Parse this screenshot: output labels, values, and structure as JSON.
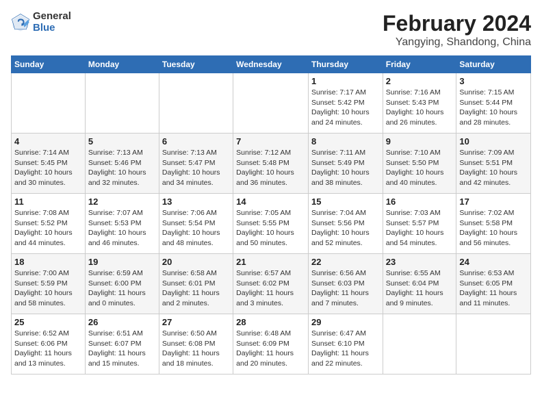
{
  "logo": {
    "general": "General",
    "blue": "Blue"
  },
  "title": "February 2024",
  "location": "Yangying, Shandong, China",
  "days_of_week": [
    "Sunday",
    "Monday",
    "Tuesday",
    "Wednesday",
    "Thursday",
    "Friday",
    "Saturday"
  ],
  "weeks": [
    [
      {
        "day": "",
        "info": ""
      },
      {
        "day": "",
        "info": ""
      },
      {
        "day": "",
        "info": ""
      },
      {
        "day": "",
        "info": ""
      },
      {
        "day": "1",
        "info": "Sunrise: 7:17 AM\nSunset: 5:42 PM\nDaylight: 10 hours and 24 minutes."
      },
      {
        "day": "2",
        "info": "Sunrise: 7:16 AM\nSunset: 5:43 PM\nDaylight: 10 hours and 26 minutes."
      },
      {
        "day": "3",
        "info": "Sunrise: 7:15 AM\nSunset: 5:44 PM\nDaylight: 10 hours and 28 minutes."
      }
    ],
    [
      {
        "day": "4",
        "info": "Sunrise: 7:14 AM\nSunset: 5:45 PM\nDaylight: 10 hours and 30 minutes."
      },
      {
        "day": "5",
        "info": "Sunrise: 7:13 AM\nSunset: 5:46 PM\nDaylight: 10 hours and 32 minutes."
      },
      {
        "day": "6",
        "info": "Sunrise: 7:13 AM\nSunset: 5:47 PM\nDaylight: 10 hours and 34 minutes."
      },
      {
        "day": "7",
        "info": "Sunrise: 7:12 AM\nSunset: 5:48 PM\nDaylight: 10 hours and 36 minutes."
      },
      {
        "day": "8",
        "info": "Sunrise: 7:11 AM\nSunset: 5:49 PM\nDaylight: 10 hours and 38 minutes."
      },
      {
        "day": "9",
        "info": "Sunrise: 7:10 AM\nSunset: 5:50 PM\nDaylight: 10 hours and 40 minutes."
      },
      {
        "day": "10",
        "info": "Sunrise: 7:09 AM\nSunset: 5:51 PM\nDaylight: 10 hours and 42 minutes."
      }
    ],
    [
      {
        "day": "11",
        "info": "Sunrise: 7:08 AM\nSunset: 5:52 PM\nDaylight: 10 hours and 44 minutes."
      },
      {
        "day": "12",
        "info": "Sunrise: 7:07 AM\nSunset: 5:53 PM\nDaylight: 10 hours and 46 minutes."
      },
      {
        "day": "13",
        "info": "Sunrise: 7:06 AM\nSunset: 5:54 PM\nDaylight: 10 hours and 48 minutes."
      },
      {
        "day": "14",
        "info": "Sunrise: 7:05 AM\nSunset: 5:55 PM\nDaylight: 10 hours and 50 minutes."
      },
      {
        "day": "15",
        "info": "Sunrise: 7:04 AM\nSunset: 5:56 PM\nDaylight: 10 hours and 52 minutes."
      },
      {
        "day": "16",
        "info": "Sunrise: 7:03 AM\nSunset: 5:57 PM\nDaylight: 10 hours and 54 minutes."
      },
      {
        "day": "17",
        "info": "Sunrise: 7:02 AM\nSunset: 5:58 PM\nDaylight: 10 hours and 56 minutes."
      }
    ],
    [
      {
        "day": "18",
        "info": "Sunrise: 7:00 AM\nSunset: 5:59 PM\nDaylight: 10 hours and 58 minutes."
      },
      {
        "day": "19",
        "info": "Sunrise: 6:59 AM\nSunset: 6:00 PM\nDaylight: 11 hours and 0 minutes."
      },
      {
        "day": "20",
        "info": "Sunrise: 6:58 AM\nSunset: 6:01 PM\nDaylight: 11 hours and 2 minutes."
      },
      {
        "day": "21",
        "info": "Sunrise: 6:57 AM\nSunset: 6:02 PM\nDaylight: 11 hours and 3 minutes."
      },
      {
        "day": "22",
        "info": "Sunrise: 6:56 AM\nSunset: 6:03 PM\nDaylight: 11 hours and 7 minutes."
      },
      {
        "day": "23",
        "info": "Sunrise: 6:55 AM\nSunset: 6:04 PM\nDaylight: 11 hours and 9 minutes."
      },
      {
        "day": "24",
        "info": "Sunrise: 6:53 AM\nSunset: 6:05 PM\nDaylight: 11 hours and 11 minutes."
      }
    ],
    [
      {
        "day": "25",
        "info": "Sunrise: 6:52 AM\nSunset: 6:06 PM\nDaylight: 11 hours and 13 minutes."
      },
      {
        "day": "26",
        "info": "Sunrise: 6:51 AM\nSunset: 6:07 PM\nDaylight: 11 hours and 15 minutes."
      },
      {
        "day": "27",
        "info": "Sunrise: 6:50 AM\nSunset: 6:08 PM\nDaylight: 11 hours and 18 minutes."
      },
      {
        "day": "28",
        "info": "Sunrise: 6:48 AM\nSunset: 6:09 PM\nDaylight: 11 hours and 20 minutes."
      },
      {
        "day": "29",
        "info": "Sunrise: 6:47 AM\nSunset: 6:10 PM\nDaylight: 11 hours and 22 minutes."
      },
      {
        "day": "",
        "info": ""
      },
      {
        "day": "",
        "info": ""
      }
    ]
  ]
}
